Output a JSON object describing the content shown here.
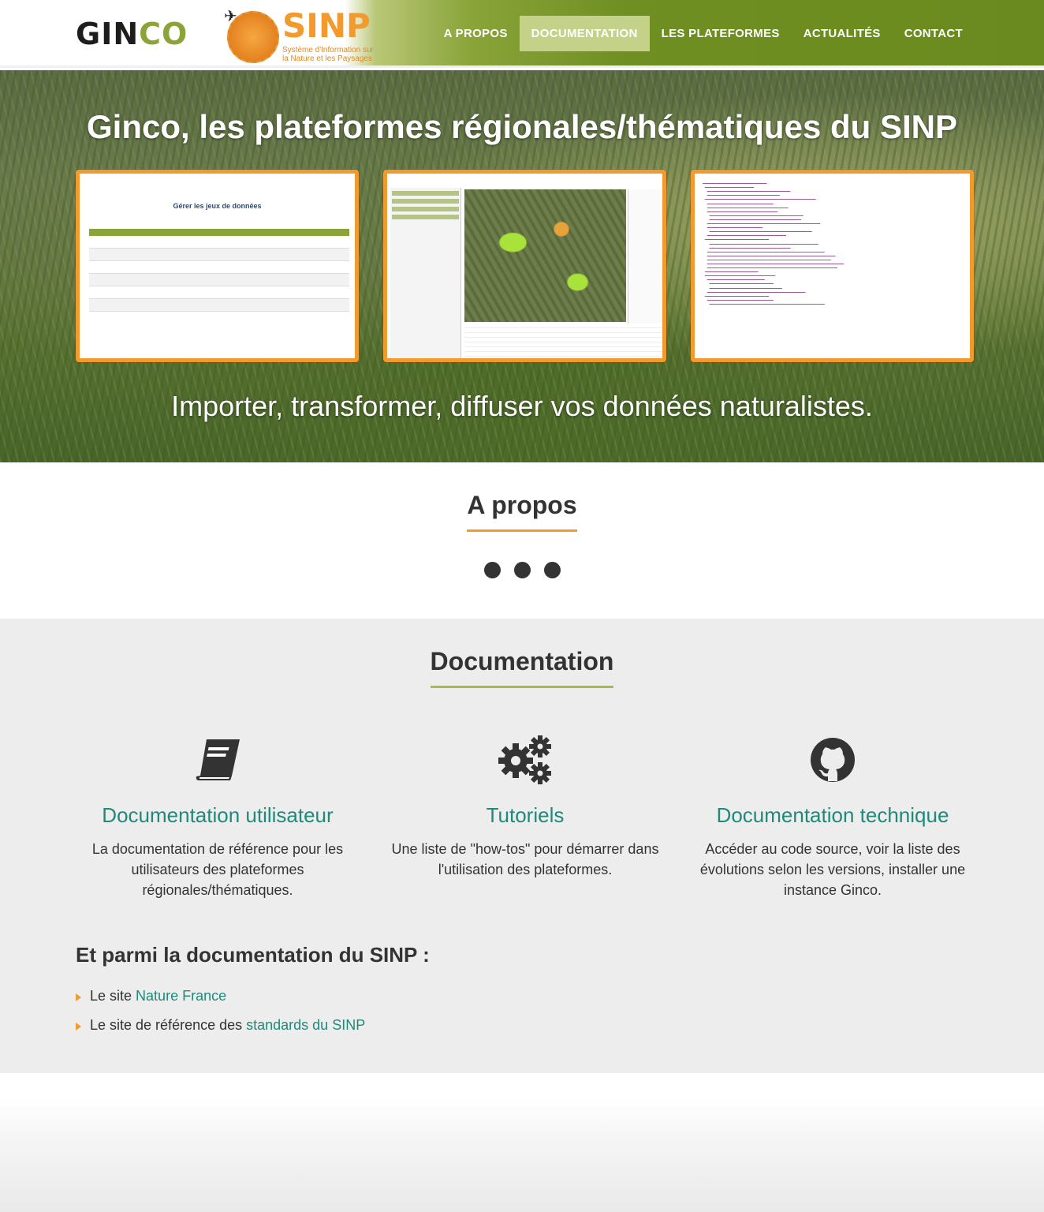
{
  "header": {
    "logo_ginco_prefix": "GIN",
    "logo_ginco_suffix": "CO",
    "logo_sinp_title": "SINP",
    "logo_sinp_subtitle": "Système d'Information sur la Nature et les Paysages",
    "nav": [
      {
        "label": "A PROPOS",
        "active": false
      },
      {
        "label": "DOCUMENTATION",
        "active": true
      },
      {
        "label": "LES PLATEFORMES",
        "active": false
      },
      {
        "label": "ACTUALITÉS",
        "active": false
      },
      {
        "label": "CONTACT",
        "active": false
      }
    ]
  },
  "hero": {
    "title": "Ginco, les plateformes régionales/thématiques du SINP",
    "tagline": "Importer, transformer, diffuser vos données naturalistes.",
    "screenshot1_title": "Gérer les jeux de données"
  },
  "apropos": {
    "title": "A propos"
  },
  "documentation": {
    "title": "Documentation",
    "columns": [
      {
        "icon": "book-icon",
        "title": "Documentation utilisateur",
        "text": "La documentation de référence pour les utilisateurs des plateformes régionales/thématiques."
      },
      {
        "icon": "gears-icon",
        "title": "Tutoriels",
        "text": "Une liste de \"how-tos\" pour démarrer dans l'utilisation des plateformes."
      },
      {
        "icon": "github-icon",
        "title": "Documentation technique",
        "text": "Accéder au code source, voir la liste des évolutions selon les versions, installer une instance Ginco."
      }
    ],
    "sinp_heading": "Et parmi la documentation du SINP :",
    "links": [
      {
        "prefix": "Le site",
        "link": "Nature France"
      },
      {
        "prefix": "Le site de référence des",
        "link": "standards du SINP"
      }
    ]
  },
  "colors": {
    "accent_orange": "#f29a2e",
    "accent_green": "#8aa43a",
    "link_teal": "#1f8a7a"
  }
}
